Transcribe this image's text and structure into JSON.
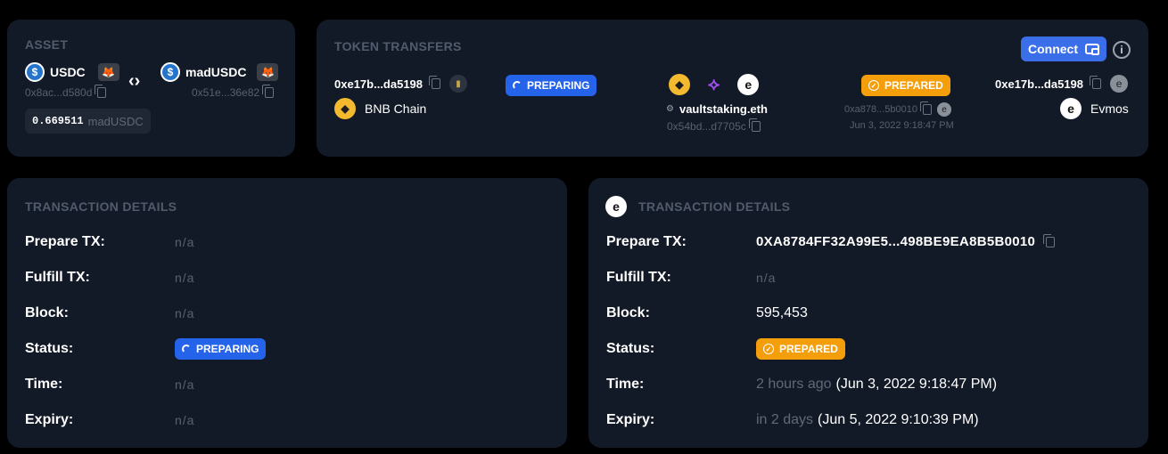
{
  "asset": {
    "title": "ASSET",
    "from_symbol": "USDC",
    "from_address": "0x8ac...d580d",
    "to_symbol": "madUSDC",
    "to_address": "0x51e...36e82",
    "amount": "0.669511",
    "amount_symbol": "madUSDC"
  },
  "transfers": {
    "title": "TOKEN TRANSFERS",
    "connect_label": "Connect",
    "sender_address": "0xe17b...da5198",
    "source_chain": "BNB Chain",
    "source_status": "PREPARING",
    "router_name": "vaultstaking.eth",
    "router_address": "0x54bd...d7705c",
    "dest_status": "PREPARED",
    "dest_tx": "0xa878...5b0010",
    "dest_time": "Jun 3, 2022 9:18:47 PM",
    "receiver_address": "0xe17b...da5198",
    "dest_chain": "Evmos"
  },
  "left_details": {
    "title": "TRANSACTION DETAILS",
    "rows": [
      {
        "label": "Prepare TX:",
        "value": "n/a"
      },
      {
        "label": "Fulfill TX:",
        "value": "n/a"
      },
      {
        "label": "Block:",
        "value": "n/a"
      },
      {
        "label": "Status:",
        "value": "PREPARING"
      },
      {
        "label": "Time:",
        "value": "n/a"
      },
      {
        "label": "Expiry:",
        "value": "n/a"
      }
    ]
  },
  "right_details": {
    "title": "TRANSACTION DETAILS",
    "prepare_label": "Prepare TX:",
    "prepare_value": "0XA8784FF32A99E5...498BE9EA8B5B0010",
    "fulfill_label": "Fulfill TX:",
    "fulfill_value": "n/a",
    "block_label": "Block:",
    "block_value": "595,453",
    "status_label": "Status:",
    "status_value": "PREPARED",
    "time_label": "Time:",
    "time_relative": "2 hours ago",
    "time_absolute": "(Jun 3, 2022 9:18:47 PM)",
    "expiry_label": "Expiry:",
    "expiry_relative": "in 2 days",
    "expiry_absolute": "(Jun 5, 2022 9:10:39 PM)"
  },
  "colors": {
    "card_bg": "#131a27",
    "accent_blue": "#2563eb",
    "accent_orange": "#f59e0b",
    "bnb_yellow": "#f3ba2f",
    "usdc_blue": "#2775ca"
  },
  "icons": [
    "usdc-icon",
    "metamask-icon",
    "swap-arrows-icon",
    "copy-icon",
    "bnb-icon",
    "evmos-icon",
    "connext-icon",
    "wallet-icon",
    "info-icon",
    "spinner-icon",
    "check-circle-icon"
  ]
}
